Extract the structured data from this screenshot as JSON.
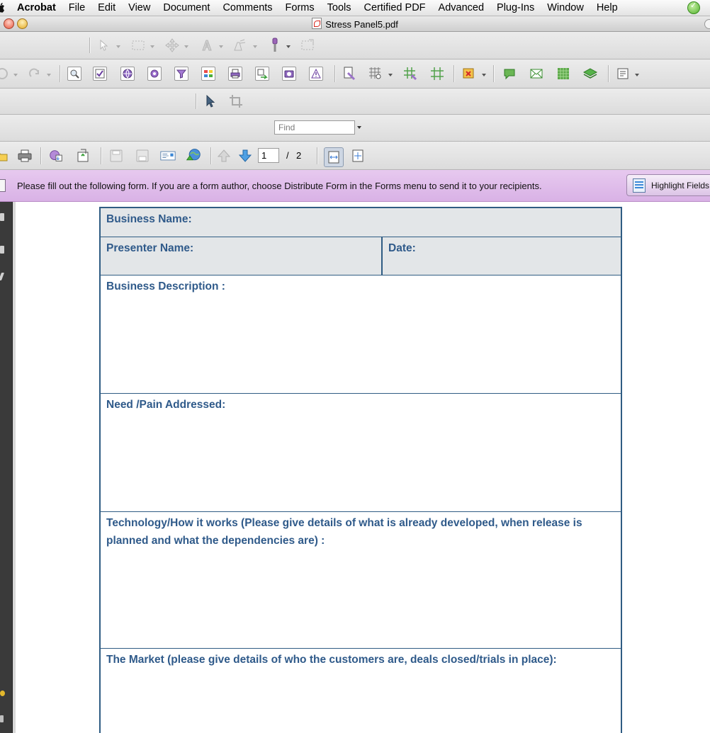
{
  "menubar": {
    "app_name": "Acrobat",
    "items": [
      "File",
      "Edit",
      "View",
      "Document",
      "Comments",
      "Forms",
      "Tools",
      "Certified PDF",
      "Advanced",
      "Plug-Ins",
      "Window",
      "Help"
    ]
  },
  "window": {
    "title": "Stress Panel5.pdf"
  },
  "find": {
    "placeholder": "Find"
  },
  "page_nav": {
    "current_page": "1",
    "separator": "/",
    "total_pages": "2"
  },
  "form_bar": {
    "message": "Please fill out the following form. If you are a form author, choose Distribute Form in the Forms menu to send it to your recipients.",
    "highlight_button": "Highlight Fields"
  },
  "form": {
    "business_name": "Business Name:",
    "presenter_name": "Presenter Name:",
    "date": "Date:",
    "business_description": "Business Description :",
    "need_pain": "Need /Pain Addressed:",
    "technology_line1": "Technology/How it works (Please give details of what is already developed, when release is",
    "technology_line2": "planned and what the dependencies are) :",
    "market": "The Market (please give details of who the customers are,  deals closed/trials in place):"
  },
  "colors": {
    "form_border": "#2f5c83",
    "form_label": "#2f5a8a",
    "form_shaded": "#e3e6e8",
    "form_bar": "#dcb8e8"
  }
}
